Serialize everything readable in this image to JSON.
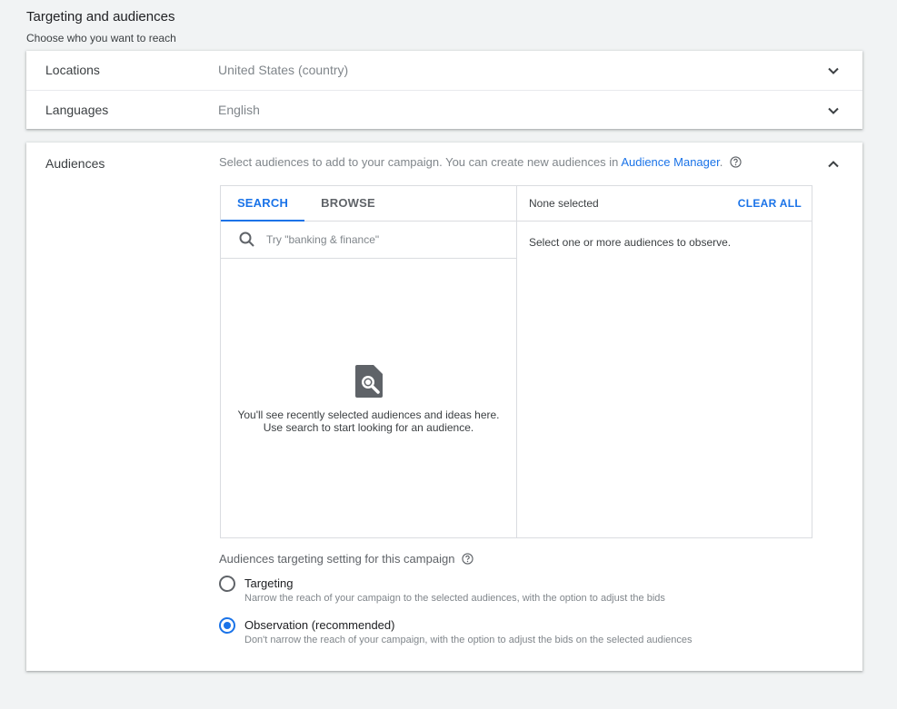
{
  "header": {
    "title": "Targeting and audiences",
    "subtitle": "Choose who you want to reach"
  },
  "locations": {
    "label": "Locations",
    "value": "United States (country)"
  },
  "languages": {
    "label": "Languages",
    "value": "English"
  },
  "audiences": {
    "label": "Audiences",
    "description": "Select audiences to add to your campaign. You can create new audiences in ",
    "link_text": "Audience Manager",
    "description_end": ".",
    "tabs": [
      "SEARCH",
      "BROWSE"
    ],
    "active_tab": "SEARCH",
    "search": {
      "placeholder": "Try \"banking & finance\"",
      "value": ""
    },
    "empty_line1": "You'll see recently selected audiences and ideas here.",
    "empty_line2": "Use search to start looking for an audience.",
    "selected_header": "None selected",
    "clear_all": "CLEAR ALL",
    "selected_hint": "Select one or more audiences to observe."
  },
  "setting": {
    "title": "Audiences targeting setting for this campaign",
    "options": [
      {
        "label": "Targeting",
        "description": "Narrow the reach of your campaign to the selected audiences, with the option to adjust the bids",
        "selected": false
      },
      {
        "label": "Observation (recommended)",
        "description": "Don't narrow the reach of your campaign, with the option to adjust the bids on the selected audiences",
        "selected": true
      }
    ]
  },
  "colors": {
    "accent": "#1a73e8",
    "background": "#f1f3f4",
    "card": "#ffffff"
  },
  "icons": [
    "chevron-down-icon",
    "chevron-up-icon",
    "help-icon",
    "search-icon",
    "search-document-icon"
  ]
}
